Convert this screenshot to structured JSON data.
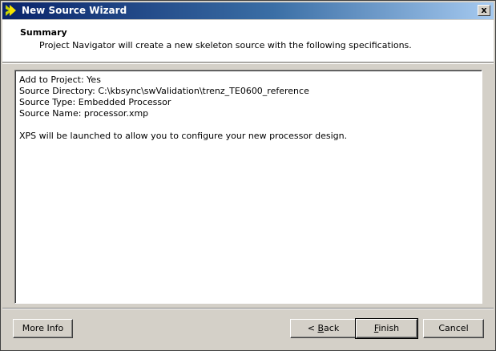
{
  "window": {
    "title": "New Source Wizard",
    "close_label": "x"
  },
  "header": {
    "title": "Summary",
    "description": "Project Navigator will create a new skeleton source with the following specifications."
  },
  "summary": {
    "lines": [
      "Add to Project: Yes",
      "Source Directory: C:\\kbsync\\swValidation\\trenz_TE0600_reference",
      "Source Type: Embedded Processor",
      "Source Name: processor.xmp"
    ],
    "note": "XPS will be launched to allow you to configure your new processor design."
  },
  "buttons": {
    "more_info": "More Info",
    "back_prefix": "< ",
    "back_mnemonic": "B",
    "back_rest": "ack",
    "finish_mnemonic": "F",
    "finish_rest": "inish",
    "cancel": "Cancel"
  },
  "icons": {
    "title_icon": "ise-logo-icon",
    "close_icon": "close-icon"
  }
}
